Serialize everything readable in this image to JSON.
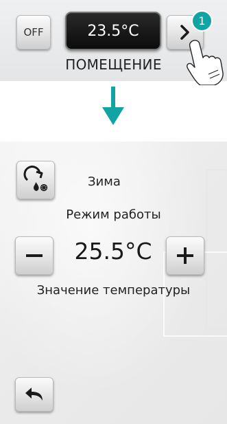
{
  "top": {
    "off_label": "OFF",
    "temperature": "23.5°C",
    "step_number": "1",
    "room_label": "ПОМЕЩЕНИЕ"
  },
  "bottom": {
    "mode_value": "Зима",
    "mode_caption": "Режим работы",
    "temperature_value": "25.5°C",
    "temperature_caption": "Значение температуры"
  },
  "colors": {
    "accent": "#12a4a3",
    "display_bg": "#111111",
    "button_face": "#e9e9e9"
  },
  "icons": [
    "chevron-right-icon",
    "hand-pointer-icon",
    "down-arrow-icon",
    "mode-cycle-icon",
    "flame-icon",
    "snowflake-icon",
    "minus-icon",
    "plus-icon",
    "back-arrow-icon"
  ]
}
